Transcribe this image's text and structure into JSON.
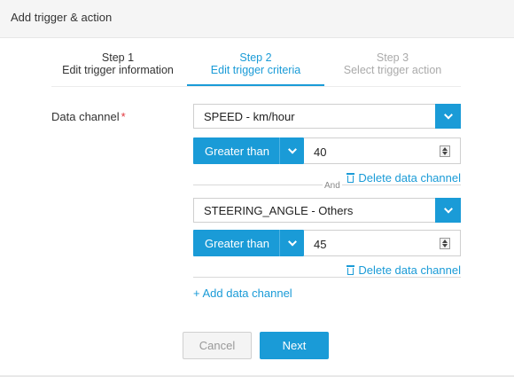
{
  "dialog": {
    "title": "Add trigger & action"
  },
  "steps": [
    {
      "number": "Step 1",
      "label": "Edit trigger information",
      "state": "complete"
    },
    {
      "number": "Step 2",
      "label": "Edit trigger criteria",
      "state": "active"
    },
    {
      "number": "Step 3",
      "label": "Select trigger action",
      "state": "upcoming"
    }
  ],
  "form": {
    "data_channel_label": "Data channel",
    "required_mark": "*",
    "channels": [
      {
        "channel": "SPEED - km/hour",
        "operator": "Greater than",
        "value": "40",
        "delete_label": "Delete data channel"
      },
      {
        "channel": "STEERING_ANGLE - Others",
        "operator": "Greater than",
        "value": "45",
        "delete_label": "Delete data channel"
      }
    ],
    "joiner": "And",
    "add_label": "+ Add data channel"
  },
  "buttons": {
    "cancel": "Cancel",
    "next": "Next"
  },
  "colors": {
    "accent": "#1a9bd7",
    "required": "#e2363d"
  }
}
